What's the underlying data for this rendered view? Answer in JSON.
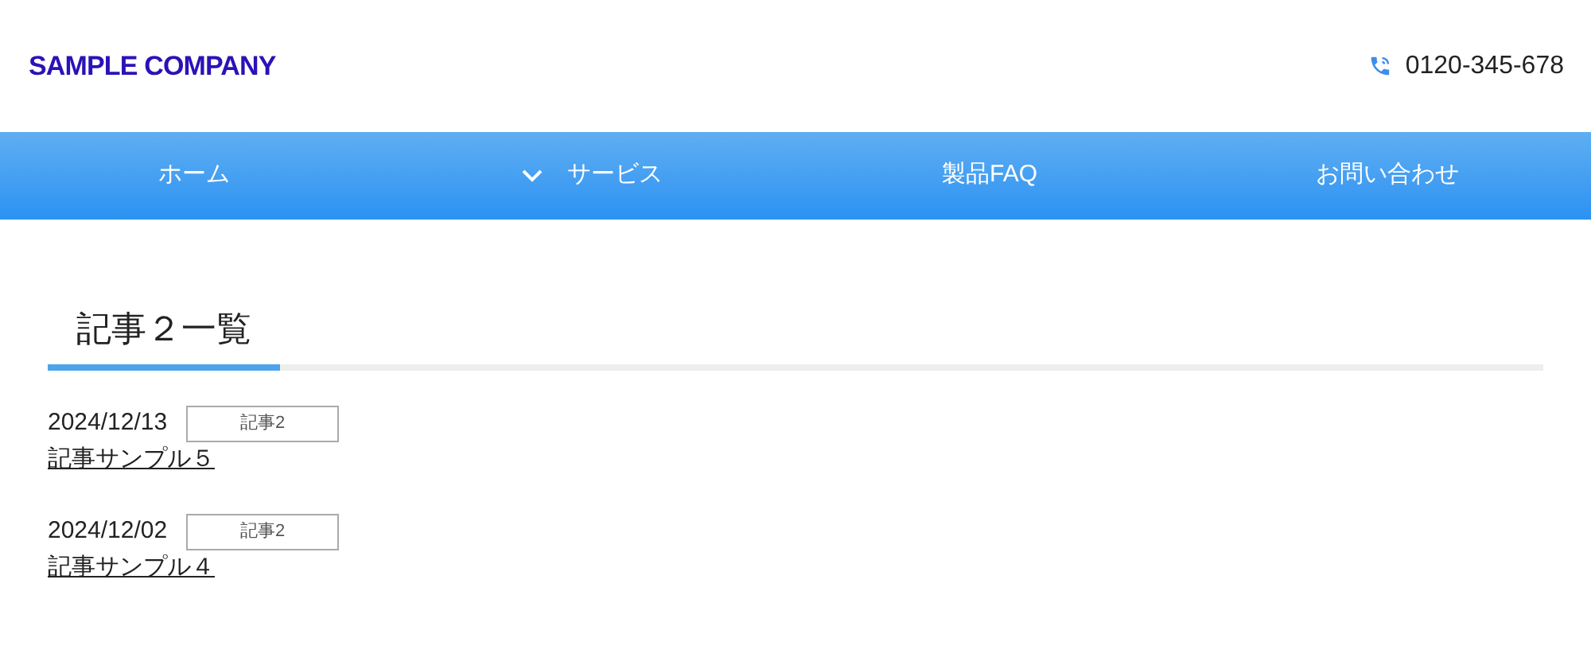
{
  "header": {
    "logo": "SAMPLE COMPANY",
    "phone": "0120-345-678"
  },
  "nav": [
    {
      "label": "ホーム",
      "has_submenu": false
    },
    {
      "label": "サービス",
      "has_submenu": true
    },
    {
      "label": "製品FAQ",
      "has_submenu": false
    },
    {
      "label": "お問い合わせ",
      "has_submenu": false
    }
  ],
  "heading": "記事２一覧",
  "posts": [
    {
      "date": "2024/12/13",
      "tag": "記事2",
      "title": "記事サンプル５"
    },
    {
      "date": "2024/12/02",
      "tag": "記事2",
      "title": "記事サンプル４"
    }
  ]
}
